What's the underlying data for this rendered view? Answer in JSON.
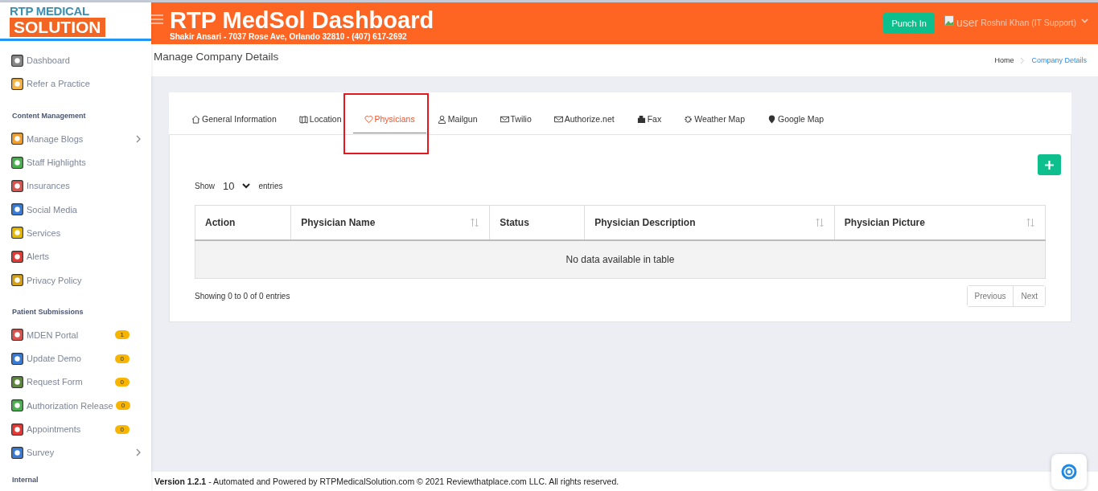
{
  "header": {
    "logo_top": "RTP MEDICAL",
    "logo_bottom": "SOLUTION",
    "title": "RTP MedSol Dashboard",
    "subtitle": "Shakir Ansari - 7037 Rose Ave, Orlando 32810 - (407) 617-2692",
    "punch_button": "Punch In",
    "user_alt": "user",
    "user_name": "Roshni Khan (IT Support)"
  },
  "sidebar": {
    "items": [
      {
        "kind": "link",
        "label": "Dashboard"
      },
      {
        "kind": "link",
        "label": "Refer a Practice"
      },
      {
        "kind": "section",
        "label": "Content Management"
      },
      {
        "kind": "link",
        "label": "Manage Blogs",
        "expandable": true
      },
      {
        "kind": "link",
        "label": "Staff Highlights"
      },
      {
        "kind": "link",
        "label": "Insurances"
      },
      {
        "kind": "link",
        "label": "Social Media"
      },
      {
        "kind": "link",
        "label": "Services"
      },
      {
        "kind": "link",
        "label": "Alerts"
      },
      {
        "kind": "link",
        "label": "Privacy Policy"
      },
      {
        "kind": "section",
        "label": "Patient Submissions"
      },
      {
        "kind": "link",
        "label": "MDEN Portal",
        "badge": "1"
      },
      {
        "kind": "link",
        "label": "Update Demo",
        "badge": "0"
      },
      {
        "kind": "link",
        "label": "Request Form",
        "badge": "0"
      },
      {
        "kind": "link",
        "label": "Authorization Release",
        "badge": "0"
      },
      {
        "kind": "link",
        "label": "Appointments",
        "badge": "0"
      },
      {
        "kind": "link",
        "label": "Survey",
        "expandable": true
      },
      {
        "kind": "section",
        "label": "Internal"
      }
    ]
  },
  "page": {
    "title": "Manage Company Details",
    "breadcrumb": [
      {
        "label": "Home",
        "selected": false
      },
      {
        "label": "Company Details",
        "selected": true
      }
    ]
  },
  "tabs": [
    {
      "label": "General Information",
      "selected": false
    },
    {
      "label": "Location",
      "selected": false
    },
    {
      "label": "Physicians",
      "selected": true
    },
    {
      "label": "Mailgun",
      "selected": false
    },
    {
      "label": "Twilio",
      "selected": false
    },
    {
      "label": "Authorize.net",
      "selected": false
    },
    {
      "label": "Fax",
      "selected": false
    },
    {
      "label": "Weather Map",
      "selected": false
    },
    {
      "label": "Google Map",
      "selected": false
    }
  ],
  "table": {
    "show_label": "Show",
    "page_size": "10",
    "entries_label": "entries",
    "columns": [
      {
        "label": "Action",
        "sortable": false
      },
      {
        "label": "Physician Name",
        "sortable": true
      },
      {
        "label": "Status",
        "sortable": false
      },
      {
        "label": "Physician Description",
        "sortable": true
      },
      {
        "label": "Physician Picture",
        "sortable": true
      }
    ],
    "empty_message": "No data available in table",
    "info": "Showing 0 to 0 of 0 entries",
    "pager": [
      "Previous",
      "Next"
    ]
  },
  "footer": {
    "version": "Version 1.2.1",
    "text": "- Automated and Powered by RTPMedicalSolution.com © 2021 Reviewthatplace.com LLC. All rights reserved."
  }
}
